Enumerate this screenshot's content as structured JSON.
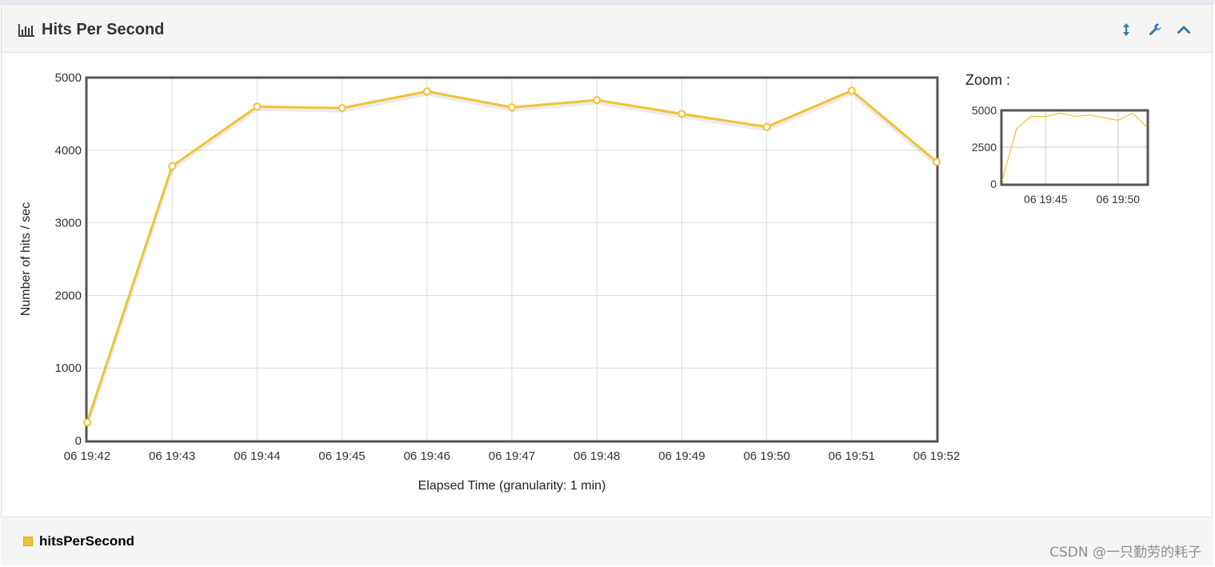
{
  "header": {
    "title": "Hits Per Second",
    "tools": [
      "resize-vertical-icon",
      "wrench-icon",
      "chevron-up-icon"
    ]
  },
  "chart_data": {
    "type": "line",
    "title": "",
    "xlabel": "Elapsed Time (granularity: 1 min)",
    "ylabel": "Number of hits / sec",
    "x": [
      "06 19:42",
      "06 19:43",
      "06 19:44",
      "06 19:45",
      "06 19:46",
      "06 19:47",
      "06 19:48",
      "06 19:49",
      "06 19:50",
      "06 19:51",
      "06 19:52"
    ],
    "ylim": [
      0,
      5000
    ],
    "yticks": [
      0,
      1000,
      2000,
      3000,
      4000,
      5000
    ],
    "grid": true,
    "series": [
      {
        "name": "hitsPerSecond",
        "color": "#f1c232",
        "values": [
          250,
          3780,
          4600,
          4580,
          4810,
          4590,
          4690,
          4500,
          4320,
          4820,
          3840
        ]
      }
    ]
  },
  "zoom": {
    "label": "Zoom :",
    "yticks": [
      "5000",
      "2500",
      "0"
    ],
    "xticks": [
      "06 19:45",
      "06 19:50"
    ]
  },
  "legend": {
    "series_label": "hitsPerSecond",
    "color": "#f1c232"
  },
  "watermark": "CSDN @一只勤劳的耗子"
}
